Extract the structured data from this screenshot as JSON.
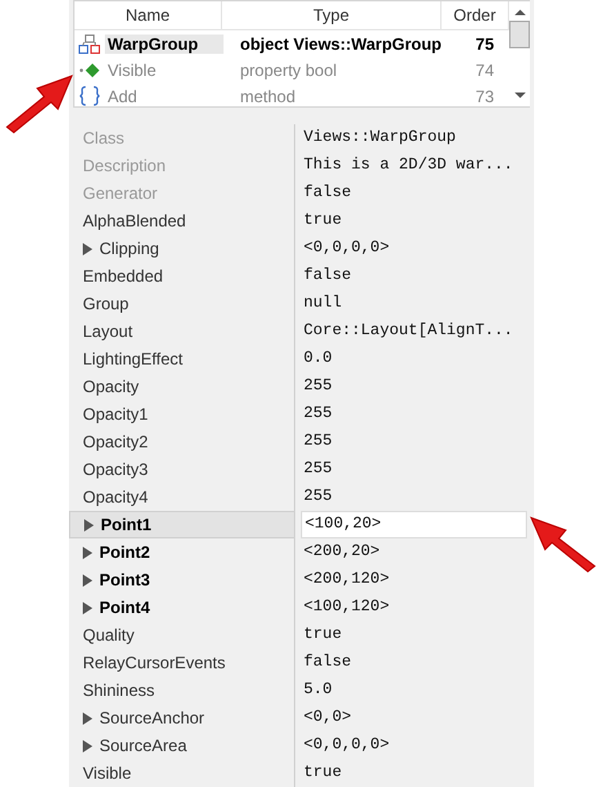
{
  "member_list": {
    "columns": [
      "Name",
      "Type",
      "Order"
    ],
    "rows": [
      {
        "kind": "class",
        "name": "WarpGroup",
        "type": "object Views::WarpGroup",
        "order": "75",
        "selected": true
      },
      {
        "kind": "property",
        "name": "Visible",
        "type": "property bool",
        "order": "74",
        "selected": false
      },
      {
        "kind": "method",
        "name": "Add",
        "type": "method",
        "order": "73",
        "selected": false
      }
    ]
  },
  "properties": [
    {
      "name": "Class",
      "value": "Views::WarpGroup",
      "readonly": true,
      "expandable": false,
      "modified": false,
      "selected": false
    },
    {
      "name": "Description",
      "value": "This is a 2D/3D war...",
      "readonly": true,
      "expandable": false,
      "modified": false,
      "selected": false
    },
    {
      "name": "Generator",
      "value": "false",
      "readonly": true,
      "expandable": false,
      "modified": false,
      "selected": false
    },
    {
      "name": "AlphaBlended",
      "value": "true",
      "readonly": false,
      "expandable": false,
      "modified": false,
      "selected": false
    },
    {
      "name": "Clipping",
      "value": "<0,0,0,0>",
      "readonly": false,
      "expandable": true,
      "modified": false,
      "selected": false
    },
    {
      "name": "Embedded",
      "value": "false",
      "readonly": false,
      "expandable": false,
      "modified": false,
      "selected": false
    },
    {
      "name": "Group",
      "value": "null",
      "readonly": false,
      "expandable": false,
      "modified": false,
      "selected": false
    },
    {
      "name": "Layout",
      "value": "Core::Layout[AlignT...",
      "readonly": false,
      "expandable": false,
      "modified": false,
      "selected": false
    },
    {
      "name": "LightingEffect",
      "value": "0.0",
      "readonly": false,
      "expandable": false,
      "modified": false,
      "selected": false
    },
    {
      "name": "Opacity",
      "value": "255",
      "readonly": false,
      "expandable": false,
      "modified": false,
      "selected": false
    },
    {
      "name": "Opacity1",
      "value": "255",
      "readonly": false,
      "expandable": false,
      "modified": false,
      "selected": false
    },
    {
      "name": "Opacity2",
      "value": "255",
      "readonly": false,
      "expandable": false,
      "modified": false,
      "selected": false
    },
    {
      "name": "Opacity3",
      "value": "255",
      "readonly": false,
      "expandable": false,
      "modified": false,
      "selected": false
    },
    {
      "name": "Opacity4",
      "value": "255",
      "readonly": false,
      "expandable": false,
      "modified": false,
      "selected": false
    },
    {
      "name": "Point1",
      "value": "<100,20>",
      "readonly": false,
      "expandable": true,
      "modified": true,
      "selected": true
    },
    {
      "name": "Point2",
      "value": "<200,20>",
      "readonly": false,
      "expandable": true,
      "modified": true,
      "selected": false
    },
    {
      "name": "Point3",
      "value": "<200,120>",
      "readonly": false,
      "expandable": true,
      "modified": true,
      "selected": false
    },
    {
      "name": "Point4",
      "value": "<100,120>",
      "readonly": false,
      "expandable": true,
      "modified": true,
      "selected": false
    },
    {
      "name": "Quality",
      "value": "true",
      "readonly": false,
      "expandable": false,
      "modified": false,
      "selected": false
    },
    {
      "name": "RelayCursorEvents",
      "value": "false",
      "readonly": false,
      "expandable": false,
      "modified": false,
      "selected": false
    },
    {
      "name": "Shininess",
      "value": "5.0",
      "readonly": false,
      "expandable": false,
      "modified": false,
      "selected": false
    },
    {
      "name": "SourceAnchor",
      "value": "<0,0>",
      "readonly": false,
      "expandable": true,
      "modified": false,
      "selected": false
    },
    {
      "name": "SourceArea",
      "value": "<0,0,0,0>",
      "readonly": false,
      "expandable": true,
      "modified": false,
      "selected": false
    },
    {
      "name": "Visible",
      "value": "true",
      "readonly": false,
      "expandable": false,
      "modified": false,
      "selected": false
    }
  ]
}
